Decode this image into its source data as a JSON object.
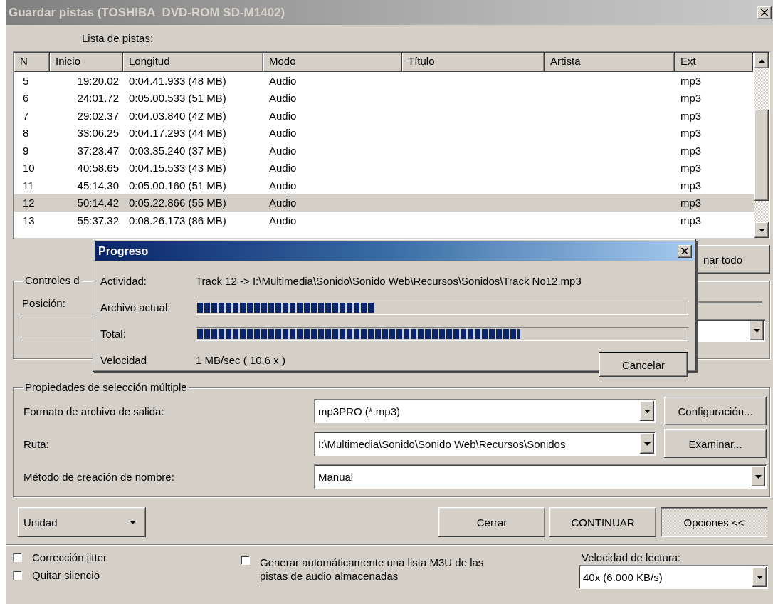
{
  "window": {
    "title": "Guardar pistas (TOSHIBA  DVD-ROM SD-M1402)"
  },
  "track_list": {
    "label": "Lista de pistas:",
    "columns": [
      "N",
      "Inicio",
      "Longitud",
      "Modo",
      "Título",
      "Artista",
      "Ext"
    ],
    "rows": [
      {
        "n": "5",
        "start": "19:20.02",
        "length": "0:04.41.933 (48 MB)",
        "mode": "Audio",
        "ext": "mp3",
        "selected": false
      },
      {
        "n": "6",
        "start": "24:01.72",
        "length": "0:05.00.533 (51 MB)",
        "mode": "Audio",
        "ext": "mp3",
        "selected": false
      },
      {
        "n": "7",
        "start": "29:02.37",
        "length": "0:04.03.840 (42 MB)",
        "mode": "Audio",
        "ext": "mp3",
        "selected": false
      },
      {
        "n": "8",
        "start": "33:06.25",
        "length": "0:04.17.293 (44 MB)",
        "mode": "Audio",
        "ext": "mp3",
        "selected": false
      },
      {
        "n": "9",
        "start": "37:23.47",
        "length": "0:03.35.240 (37 MB)",
        "mode": "Audio",
        "ext": "mp3",
        "selected": false
      },
      {
        "n": "10",
        "start": "40:58.65",
        "length": "0:04.15.533 (43 MB)",
        "mode": "Audio",
        "ext": "mp3",
        "selected": false
      },
      {
        "n": "11",
        "start": "45:14.30",
        "length": "0:05.00.160 (51 MB)",
        "mode": "Audio",
        "ext": "mp3",
        "selected": false
      },
      {
        "n": "12",
        "start": "50:14.42",
        "length": "0:05.22.866 (55 MB)",
        "mode": "Audio",
        "ext": "mp3",
        "selected": true
      },
      {
        "n": "13",
        "start": "55:37.32",
        "length": "0:08.26.173 (86 MB)",
        "mode": "Audio",
        "ext": "mp3",
        "selected": false
      }
    ]
  },
  "hidden_controls": {
    "button": "nar todo",
    "group_title": "Controles d",
    "position_label": "Posición:"
  },
  "progress_dialog": {
    "title": "Progreso",
    "rows": [
      {
        "kind": "text",
        "label": "Actividad:",
        "value": "Track 12 -> I:\\Multimedia\\Sonido\\Sonido Web\\Recursos\\Sonidos\\Track No12.mp3"
      },
      {
        "kind": "bar",
        "label": "Archivo actual:",
        "level": 0.36
      },
      {
        "kind": "bar",
        "label": "Total:",
        "level": 0.66
      },
      {
        "kind": "text",
        "label": "Velocidad",
        "value": "1 MB/sec ( 10,6 x )"
      }
    ],
    "cancel_button": "Cancelar"
  },
  "multi_selection": {
    "title": "Propiedades de selección múltiple",
    "rows": [
      {
        "label": "Formato de archivo de salida:",
        "value": "mp3PRO (*.mp3)",
        "button": "Configuración..."
      },
      {
        "label": "Ruta:",
        "value": "I:\\Multimedia\\Sonido\\Sonido Web\\Recursos\\Sonidos",
        "button": "Examinar..."
      },
      {
        "label": "Método de creación de nombre:",
        "value": "Manual"
      }
    ]
  },
  "drive_button": "Unidad",
  "buttons": [
    {
      "label": "Cerrar",
      "pressed": false
    },
    {
      "label": "CONTINUAR",
      "pressed": false
    },
    {
      "label": "Opciones <<",
      "pressed": true
    }
  ],
  "options": [
    {
      "label": "Corrección jitter",
      "checked": false
    },
    {
      "label": "Quitar silencio",
      "checked": false
    },
    {
      "label": "Generar automáticamente una lista M3U de las pistas de audio almacenadas",
      "checked": false
    }
  ],
  "read_speed": {
    "label": "Velocidad de lectura:",
    "value": "40x (6.000 KB/s)"
  }
}
